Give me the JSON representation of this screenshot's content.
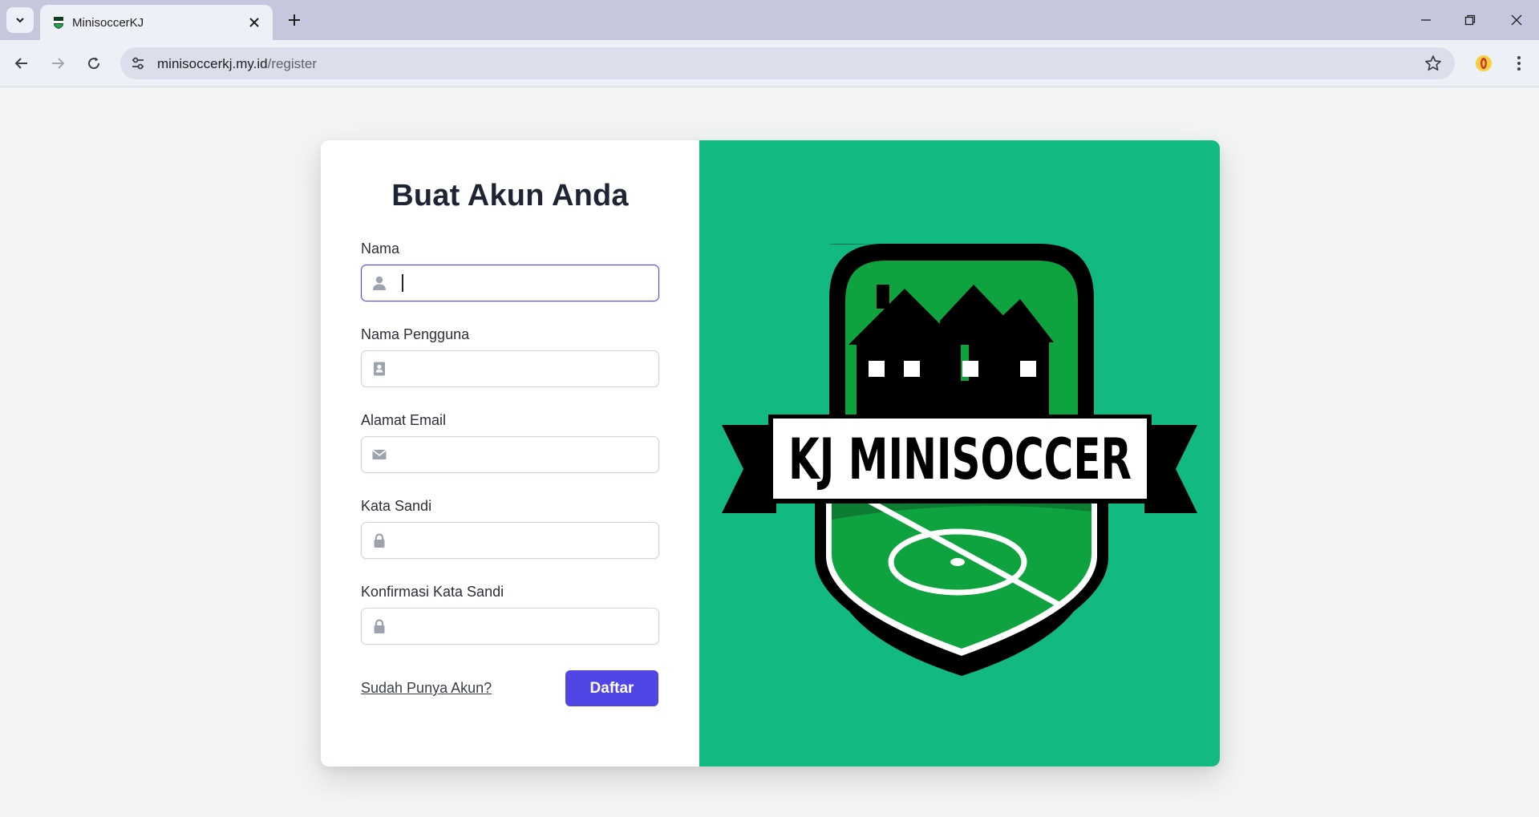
{
  "browser": {
    "tab_title": "MinisoccerKJ",
    "url_domain": "minisoccerkj.my.id",
    "url_path": "/register"
  },
  "icons": {
    "tab_list": "chevron-down-icon",
    "favicon": "soccer-badge-icon",
    "close": "close-icon",
    "new_tab": "plus-icon",
    "back": "arrow-left-icon",
    "forward": "arrow-right-icon",
    "reload": "reload-icon",
    "site_info": "tune-icon",
    "bookmark": "star-icon",
    "extension": "extension-icon",
    "menu": "kebab-menu-icon"
  },
  "form": {
    "title": "Buat Akun Anda",
    "fields": [
      {
        "label": "Nama",
        "value": "",
        "icon": "user-icon",
        "focused": true
      },
      {
        "label": "Nama Pengguna",
        "value": "",
        "icon": "id-card-icon",
        "focused": false
      },
      {
        "label": "Alamat Email",
        "value": "",
        "icon": "envelope-icon",
        "focused": false
      },
      {
        "label": "Kata Sandi",
        "value": "",
        "icon": "lock-icon",
        "focused": false
      },
      {
        "label": "Konfirmasi Kata Sandi",
        "value": "",
        "icon": "lock-icon",
        "focused": false
      }
    ],
    "login_link": "Sudah Punya Akun?",
    "submit_label": "Daftar"
  },
  "logo": {
    "text": "KJ MINISOCCER"
  },
  "colors": {
    "accent": "#4f46e5",
    "panel_green": "#12b980",
    "field_green": "#0ea33f",
    "page_bg": "#f3f4f6"
  }
}
